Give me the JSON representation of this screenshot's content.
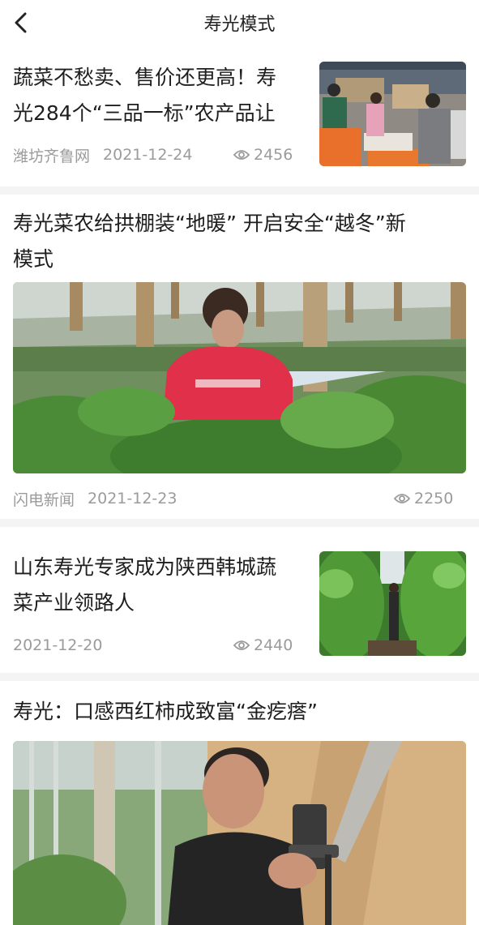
{
  "header": {
    "title": "寿光模式"
  },
  "articles": [
    {
      "title_lines": [
        "蔬菜不愁卖、售价还更高！寿",
        "光284个“三品一标”农产品让"
      ],
      "source": "潍坊齐鲁网",
      "date": "2021-12-24",
      "views": "2456",
      "image_icon": "market-packing-photo"
    },
    {
      "title_lines": [
        "寿光菜农给拱棚装“地暖” 开启安全“越冬”新",
        "模式"
      ],
      "source": "闪电新闻",
      "date": "2021-12-23",
      "views": "2250",
      "image_icon": "greenhouse-farmer-photo"
    },
    {
      "title_lines": [
        "山东寿光专家成为陕西韩城蔬",
        "菜产业领路人"
      ],
      "source": "",
      "date": "2021-12-20",
      "views": "2440",
      "image_icon": "vine-greenhouse-photo"
    },
    {
      "title_lines": [
        "寿光：口感西红柿成致富“金疙瘩”"
      ],
      "image_icon": "livestream-farmer-photo"
    }
  ]
}
